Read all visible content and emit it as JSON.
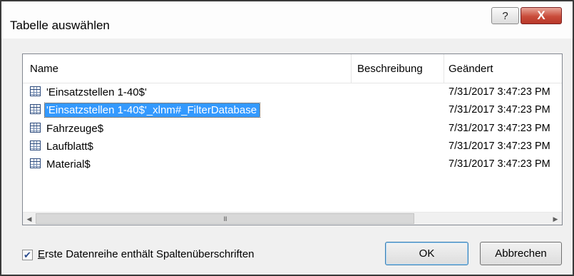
{
  "dialog": {
    "title": "Tabelle auswählen",
    "help_glyph": "?",
    "close_glyph": "X"
  },
  "list": {
    "columns": {
      "name": "Name",
      "description": "Beschreibung",
      "changed": "Geändert"
    },
    "rows": [
      {
        "name": "'Einsatzstellen 1-40$'",
        "description": "",
        "changed": "7/31/2017 3:47:23 PM",
        "selected": false
      },
      {
        "name": "'Einsatzstellen 1-40$'_xlnm#_FilterDatabase",
        "description": "",
        "changed": "7/31/2017 3:47:23 PM",
        "selected": true
      },
      {
        "name": "Fahrzeuge$",
        "description": "",
        "changed": "7/31/2017 3:47:23 PM",
        "selected": false
      },
      {
        "name": "Laufblatt$",
        "description": "",
        "changed": "7/31/2017 3:47:23 PM",
        "selected": false
      },
      {
        "name": "Material$",
        "description": "",
        "changed": "7/31/2017 3:47:23 PM",
        "selected": false
      }
    ],
    "scrollbar": {
      "left_arrow": "◀",
      "right_arrow": "▶",
      "grip": "III"
    }
  },
  "options": {
    "first_row_headers": {
      "checked": true,
      "check_glyph": "✔",
      "label_first": "E",
      "label_rest": "rste Datenreihe enthält Spaltenüberschriften"
    }
  },
  "buttons": {
    "ok": "OK",
    "cancel": "Abbrechen"
  },
  "colors": {
    "selection": "#3399ff",
    "close_button": "#c94c3a"
  }
}
